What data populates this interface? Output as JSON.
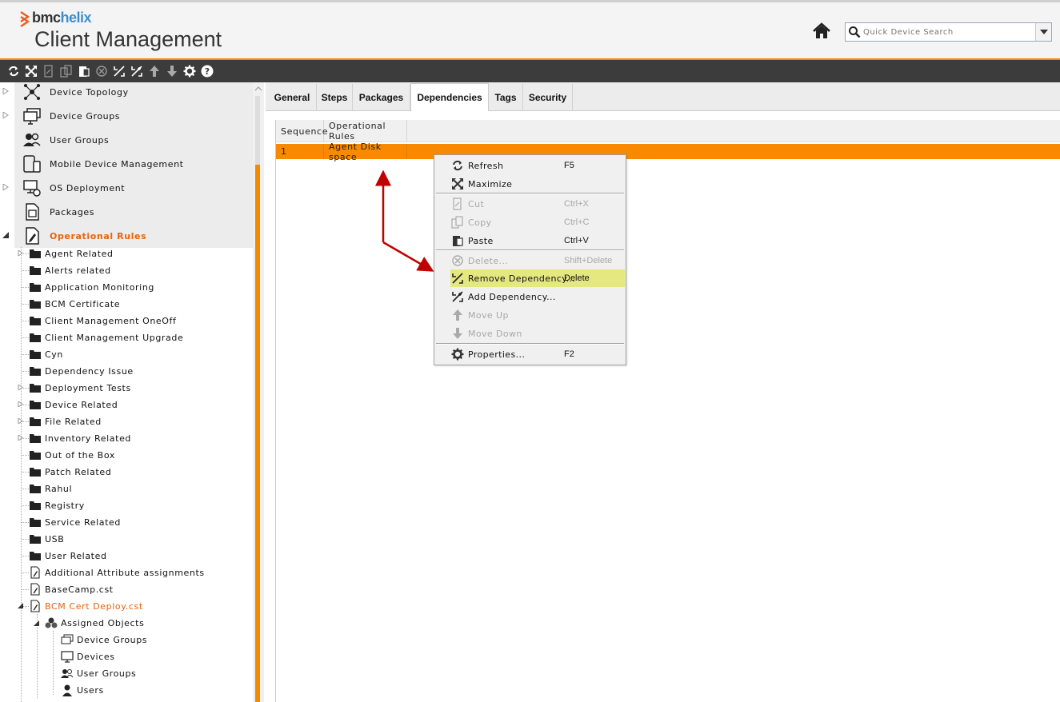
{
  "header": {
    "brand_bmc": "bmc",
    "brand_helix": "helix",
    "product_title": "Client Management",
    "search": {
      "placeholder": "Quick Device Search"
    }
  },
  "toolbar": {
    "icons": [
      "refresh-icon",
      "maximize-icon",
      "cut-icon",
      "copy-icon",
      "paste-icon",
      "delete-icon",
      "remove-dependency-icon",
      "add-dependency-icon",
      "move-up-icon",
      "move-down-icon",
      "settings-icon",
      "help-icon"
    ]
  },
  "nav": {
    "items": [
      {
        "label": "Device Topology",
        "icon": "topology-icon"
      },
      {
        "label": "Device Groups",
        "icon": "device-groups-icon"
      },
      {
        "label": "User Groups",
        "icon": "user-groups-icon"
      },
      {
        "label": "Mobile Device Management",
        "icon": "mobile-device-icon"
      },
      {
        "label": "OS Deployment",
        "icon": "os-deployment-icon"
      },
      {
        "label": "Packages",
        "icon": "packages-icon"
      },
      {
        "label": "Operational Rules",
        "icon": "operational-rules-icon",
        "active": true
      }
    ]
  },
  "tree": {
    "folders": [
      "Agent Related",
      "Alerts related",
      "Application Monitoring",
      "BCM Certificate",
      "Client Management OneOff",
      "Client Management Upgrade",
      "Cyn",
      "Dependency Issue",
      "Deployment Tests",
      "Device Related",
      "File Related",
      "Inventory Related",
      "Out of the Box",
      "Patch Related",
      "Rahul",
      "Registry",
      "Service Related",
      "USB",
      "User Related"
    ],
    "rules": [
      "Additional Attribute assignments",
      "BaseCamp.cst",
      "BCM Cert Deploy.cst"
    ],
    "assigned_objects": "Assigned Objects",
    "assigned_children": [
      "Device Groups",
      "Devices",
      "User Groups",
      "Users"
    ]
  },
  "tabs": [
    "General",
    "Steps",
    "Packages",
    "Dependencies",
    "Tags",
    "Security"
  ],
  "active_tab": "Dependencies",
  "table": {
    "columns": [
      "Sequence",
      "Operational Rules"
    ],
    "rows": [
      {
        "sequence": "1",
        "rule": "Agent Disk space"
      }
    ]
  },
  "context_menu": {
    "items": [
      {
        "label": "Refresh",
        "shortcut": "F5",
        "icon": "refresh-icon",
        "enabled": true
      },
      {
        "label": "Maximize",
        "shortcut": "",
        "icon": "maximize-icon",
        "enabled": true
      },
      {
        "label": "Cut",
        "shortcut": "Ctrl+X",
        "icon": "cut-icon",
        "enabled": false
      },
      {
        "label": "Copy",
        "shortcut": "Ctrl+C",
        "icon": "copy-icon",
        "enabled": false
      },
      {
        "label": "Paste",
        "shortcut": "Ctrl+V",
        "icon": "paste-icon",
        "enabled": true
      },
      {
        "label": "Delete...",
        "shortcut": "Shift+Delete",
        "icon": "delete-icon",
        "enabled": false
      },
      {
        "label": "Remove Dependency...",
        "shortcut": "Delete",
        "icon": "remove-dependency-icon",
        "enabled": true,
        "highlighted": true
      },
      {
        "label": "Add Dependency...",
        "shortcut": "",
        "icon": "add-dependency-icon",
        "enabled": true
      },
      {
        "label": "Move Up",
        "shortcut": "",
        "icon": "move-up-icon",
        "enabled": false
      },
      {
        "label": "Move Down",
        "shortcut": "",
        "icon": "move-down-icon",
        "enabled": false
      },
      {
        "label": "Properties...",
        "shortcut": "F2",
        "icon": "properties-icon",
        "enabled": true
      }
    ]
  },
  "colors": {
    "accent_orange": "#f98900",
    "highlight_text": "#e8630a",
    "menu_highlight": "#e5e87e",
    "annotation_arrow": "#c00000"
  }
}
